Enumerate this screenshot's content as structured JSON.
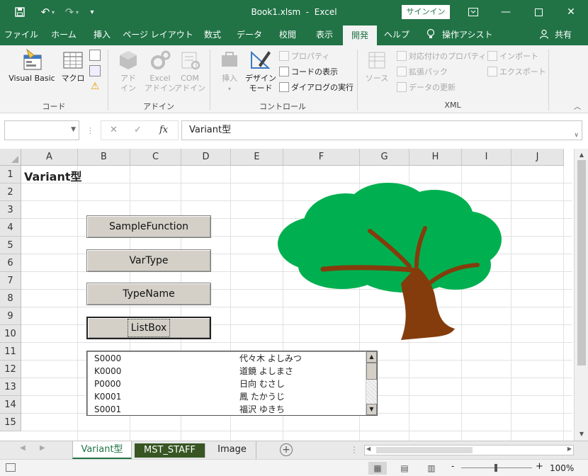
{
  "titlebar": {
    "filename": "Book1.xlsm",
    "separator": "-",
    "app": "Excel",
    "signin_label": "サインイン",
    "window_buttons": [
      "ribbon-display-icon",
      "minimize-icon",
      "maximize-icon",
      "close-icon"
    ]
  },
  "ribbon_tabs": [
    "ファイル",
    "ホーム",
    "挿入",
    "ページ レイアウト",
    "数式",
    "データ",
    "校閲",
    "表示",
    "開発",
    "ヘルプ",
    "操作アシスト",
    "共有"
  ],
  "active_tab": "開発",
  "ribbon": {
    "code": {
      "label": "コード",
      "visual_basic": "Visual Basic",
      "macro": "マクロ"
    },
    "addins": {
      "label": "アドイン",
      "addin": [
        "アド",
        "イン"
      ],
      "excel_addin": [
        "Excel",
        "アドイン"
      ],
      "com_addin": [
        "COM",
        "アドイン"
      ]
    },
    "controls": {
      "label": "コントロール",
      "insert": [
        "挿入"
      ],
      "design_mode": [
        "デザイン",
        "モード"
      ],
      "properties": "プロパティ",
      "view_code": "コードの表示",
      "run_dialog": "ダイアログの実行"
    },
    "xml": {
      "label": "XML",
      "source": "ソース",
      "map_properties": "対応付けのプロパティ",
      "expansion_packs": "拡張パック",
      "refresh_data": "データの更新",
      "import": "インポート",
      "export": "エクスポート"
    }
  },
  "formula_bar": {
    "name_box": "",
    "fx": "fx",
    "content": "Variant型"
  },
  "columns": [
    "A",
    "B",
    "C",
    "D",
    "E",
    "F",
    "G",
    "H",
    "I",
    "J"
  ],
  "rows": [
    "1",
    "2",
    "3",
    "4",
    "5",
    "6",
    "7",
    "8",
    "9",
    "10",
    "11",
    "12",
    "13",
    "14",
    "15"
  ],
  "cell_a1": "Variant型",
  "form_buttons": [
    "SampleFunction",
    "VarType",
    "TypeName",
    "ListBox"
  ],
  "listbox_items": [
    [
      "S0000",
      "代々木 よしみつ"
    ],
    [
      "K0000",
      "道鏡 よしまさ"
    ],
    [
      "P0000",
      "日向 むさし"
    ],
    [
      "K0001",
      "鳳 たかうじ"
    ],
    [
      "S0001",
      "福沢 ゆきち"
    ]
  ],
  "sheet_tabs": [
    "Variant型",
    "MST_STAFF",
    "Image"
  ],
  "active_sheet": "Variant型",
  "status": {
    "zoom": "100%",
    "zoom_minus": "-",
    "zoom_plus": "+"
  },
  "colors": {
    "excel_green": "#217346",
    "tree_foliage": "#00b050",
    "tree_trunk": "#843c0c",
    "mst_staff_tab": "#375623"
  }
}
